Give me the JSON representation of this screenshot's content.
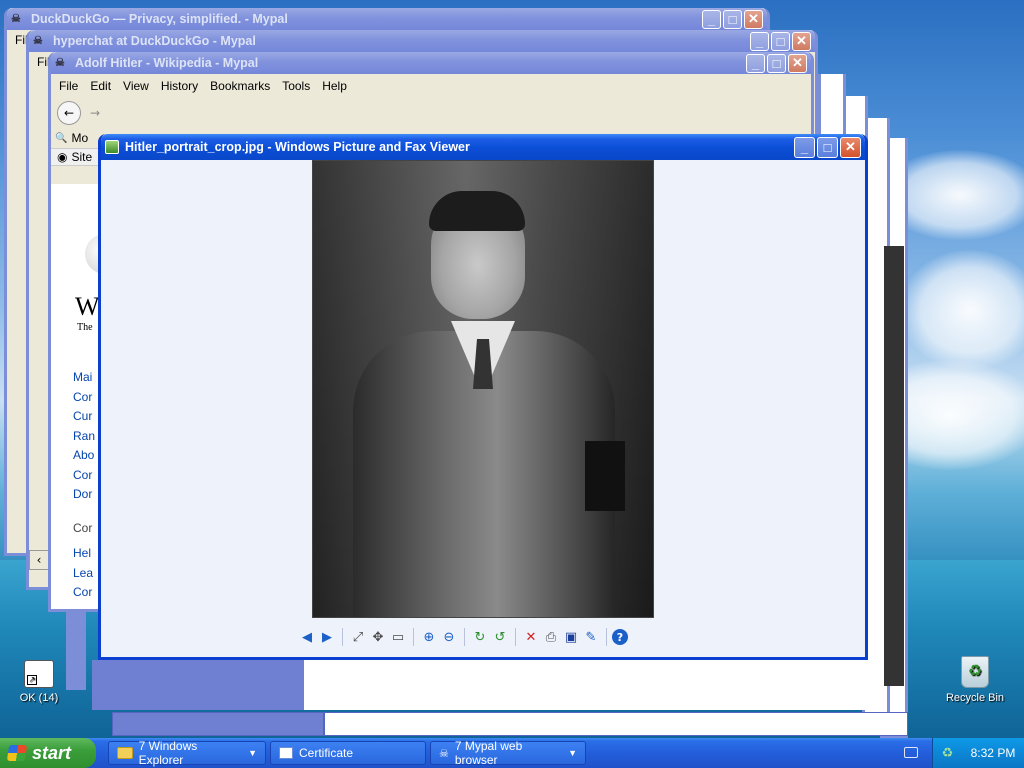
{
  "desktop": {
    "icons": [
      {
        "label": "OK (14)"
      },
      {
        "label": "Recycle Bin"
      }
    ]
  },
  "windows": {
    "ddg": {
      "title": "DuckDuckGo — Privacy, simplified. - Mypal",
      "menu_first": "Fil"
    },
    "hyperchat": {
      "title": "hyperchat at DuckDuckGo - Mypal",
      "menu_first": "Fil"
    },
    "wiki": {
      "title": "Adolf Hitler - Wikipedia - Mypal",
      "menu": [
        "File",
        "Edit",
        "View",
        "History",
        "Bookmarks",
        "Tools",
        "Help"
      ],
      "bookmark_label": "Mo",
      "site_label": "Site",
      "sidebar_links": [
        "Mai",
        "Cor",
        "Cur",
        "Ran",
        "Abo",
        "Cor",
        "Dor",
        "Cor",
        "Hel",
        "Lea",
        "Cor"
      ],
      "logo_letter": "W",
      "tagline": "The"
    },
    "viewer": {
      "title": "Hitler_portrait_crop.jpg - Windows Picture and Fax Viewer",
      "image_alt": "Black and white portrait photo"
    }
  },
  "viewer_toolbar": [
    {
      "name": "previous-image",
      "glyph": "◀"
    },
    {
      "name": "next-image",
      "glyph": "▶"
    },
    {
      "name": "best-fit",
      "glyph": "⤢"
    },
    {
      "name": "actual-size",
      "glyph": "✥"
    },
    {
      "name": "slideshow",
      "glyph": "▭"
    },
    {
      "name": "zoom-in",
      "glyph": "⊕"
    },
    {
      "name": "zoom-out",
      "glyph": "⊖"
    },
    {
      "name": "rotate-clockwise",
      "glyph": "↻"
    },
    {
      "name": "rotate-counterclockwise",
      "glyph": "↺"
    },
    {
      "name": "delete",
      "glyph": "✕"
    },
    {
      "name": "print",
      "glyph": "⎙"
    },
    {
      "name": "copy-to",
      "glyph": "▣"
    },
    {
      "name": "edit",
      "glyph": "✎"
    },
    {
      "name": "help",
      "glyph": "?"
    }
  ],
  "taskbar": {
    "start_label": "start",
    "tasks": [
      {
        "label": "7 Windows Explorer",
        "icon": "folder-icon"
      },
      {
        "label": "Certificate",
        "icon": "window-icon"
      },
      {
        "label": "7 Mypal web browser",
        "icon": "mypal-icon"
      }
    ],
    "clock": "8:32 PM"
  },
  "colors": {
    "title_active": "#0b4ed6",
    "title_inactive": "#8192dd",
    "close_red": "#d4512c",
    "start_green": "#3a9e3a"
  }
}
